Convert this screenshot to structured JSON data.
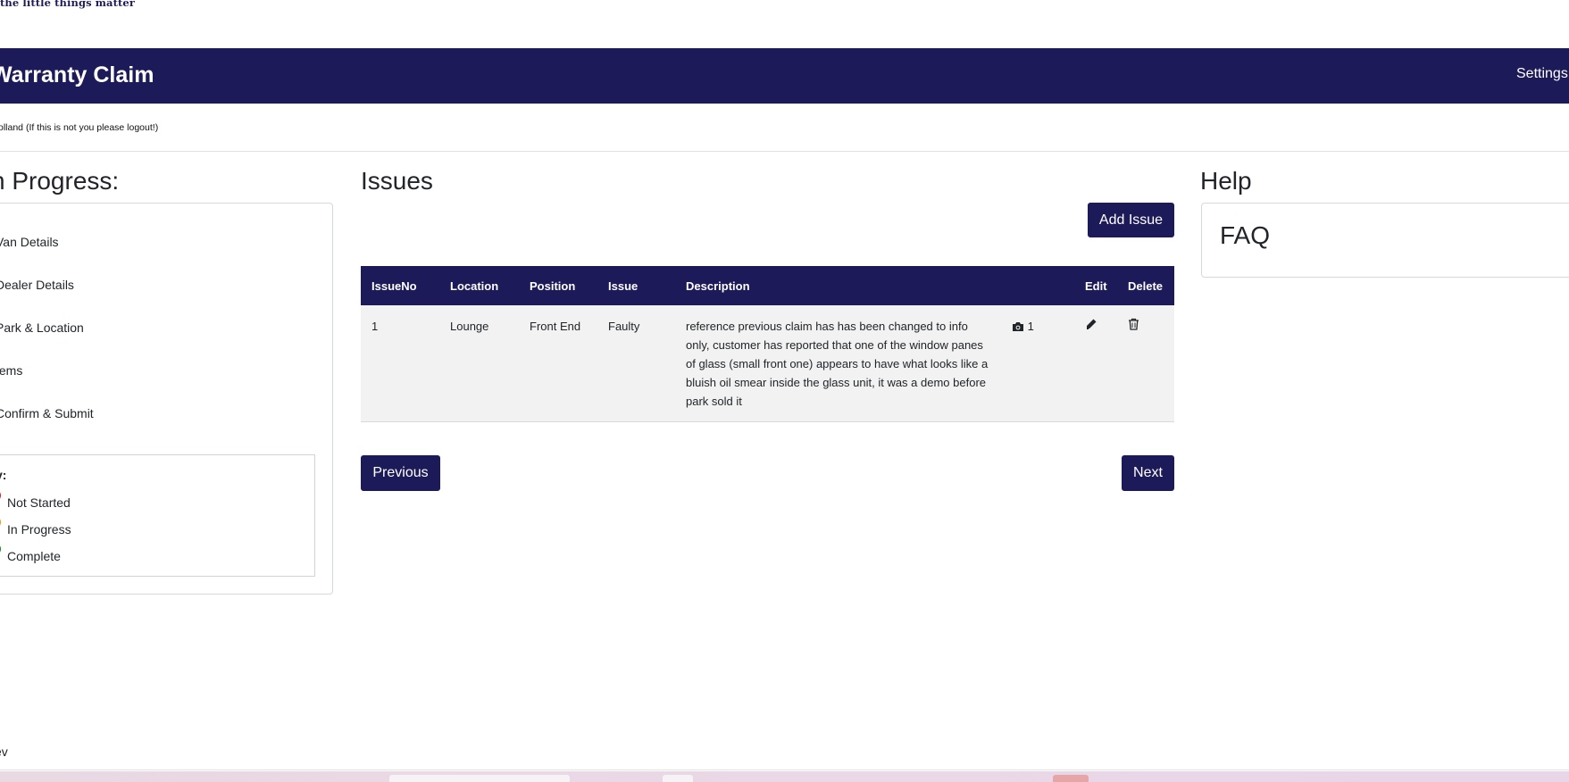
{
  "brand": {
    "tagline": "the little things matter"
  },
  "header": {
    "title": "Warranty Claim",
    "settings_label": "Settings"
  },
  "user": {
    "line": "olland (If this is not you please logout!)"
  },
  "progress": {
    "heading": "n Progress:",
    "steps": [
      {
        "label": "Van Details"
      },
      {
        "label": "Dealer Details"
      },
      {
        "label": "Park & Location"
      },
      {
        "label": "tems"
      },
      {
        "label": "Confirm & Submit"
      }
    ],
    "key": {
      "title": "y:",
      "items": [
        {
          "label": "Not Started",
          "color": "#e8141e"
        },
        {
          "label": "In Progress",
          "color": "#f39200"
        },
        {
          "label": "Complete",
          "color": "#0a8a28"
        }
      ]
    }
  },
  "issues": {
    "heading": "Issues",
    "add_button": "Add Issue",
    "columns": [
      "IssueNo",
      "Location",
      "Position",
      "Issue",
      "Description",
      "",
      "Edit",
      "Delete"
    ],
    "rows": [
      {
        "issue_no": "1",
        "location": "Lounge",
        "position": "Front End",
        "issue": "Faulty",
        "description": "reference previous claim has has been changed to info only, customer has reported that one of the window panes of glass (small front one) appears to have what looks like a bluish oil smear inside the glass unit, it was a demo before park sold it",
        "photo_count": "1"
      }
    ],
    "previous_button": "Previous",
    "next_button": "Next"
  },
  "help": {
    "heading": "Help",
    "faq_label": "FAQ"
  },
  "footer": {
    "text": "ev"
  },
  "icons": {
    "camera": "camera-icon",
    "edit": "pencil-icon",
    "delete": "trash-icon"
  },
  "colors": {
    "brand_navy": "#1d1a59",
    "row_bg": "#f2f2f2"
  }
}
